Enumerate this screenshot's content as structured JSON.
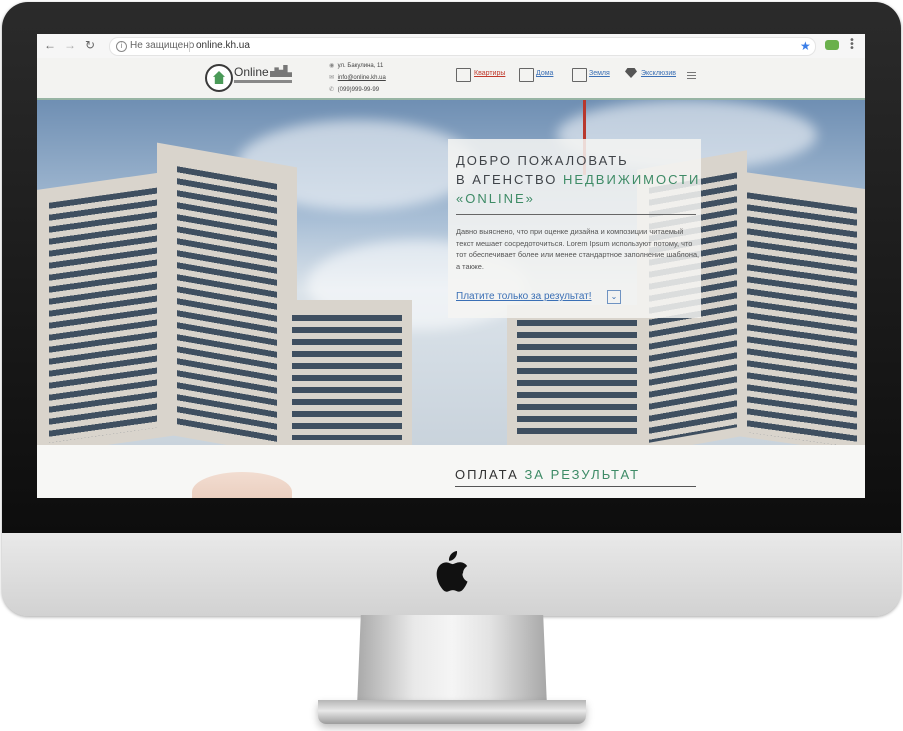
{
  "browser": {
    "security_text": "Не защищено",
    "url": "online.kh.ua"
  },
  "site": {
    "logo_text": "Online",
    "contacts": {
      "address": "ул. Бакулина, 11",
      "email": "info@online.kh.ua",
      "phone": "(099)999-99-99"
    },
    "nav": [
      {
        "label": "Квартиры",
        "icon": "apartment-icon",
        "active": true
      },
      {
        "label": "Дома",
        "icon": "house-icon",
        "active": false
      },
      {
        "label": "Земля",
        "icon": "land-icon",
        "active": false
      },
      {
        "label": "Эксклюзив",
        "icon": "diamond-icon",
        "active": false
      }
    ]
  },
  "hero": {
    "title_line1": "ДОБРО ПОЖАЛОВАТЬ",
    "title_line2_plain": "В АГЕНСТВО",
    "title_line2_accent": "НЕДВИЖИМОСТИ",
    "title_line3_accent": "«ONLINE»",
    "body": "Давно выяснено, что при оценке дизайна и композиции читаемый текст мешает сосредоточиться. Lorem Ipsum используют потому, что тот обеспечивает более или менее стандартное заполнение шаблона, а также.",
    "link": "Платите только за результат!"
  },
  "section": {
    "title_plain": "ОПЛАТА",
    "title_accent": "ЗА РЕЗУЛЬТАТ"
  },
  "colors": {
    "accent": "#3e8b66",
    "link": "#3a6fb5",
    "active_nav": "#c0392b"
  }
}
